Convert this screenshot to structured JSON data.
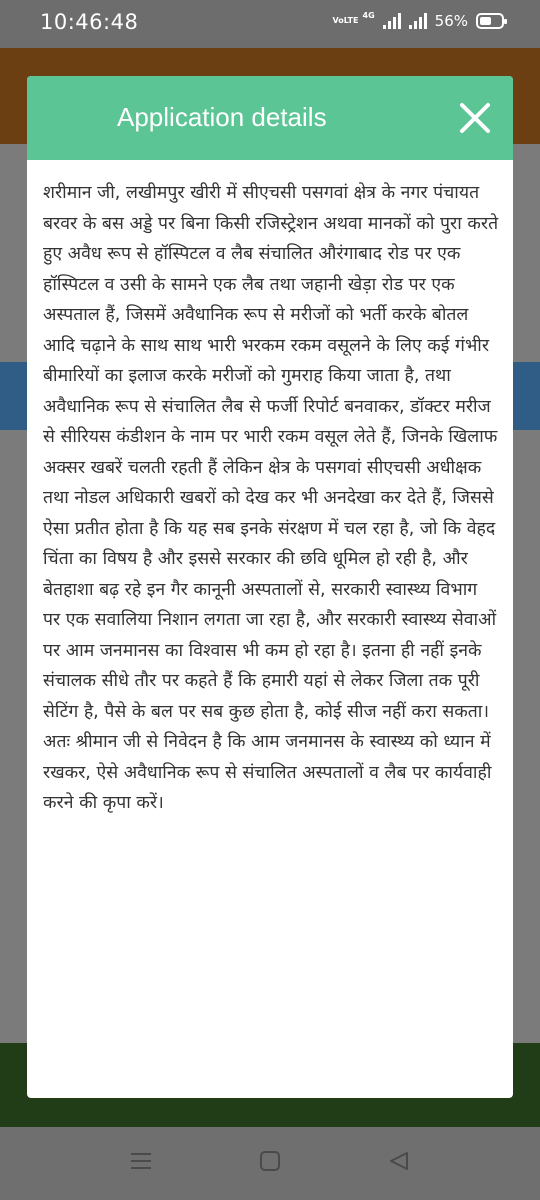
{
  "status_bar": {
    "time": "10:46:48",
    "volte_label": "VoLTE",
    "network": "4G",
    "battery_percent": "56%",
    "battery_level": 0.56
  },
  "dialog": {
    "title": "Application details",
    "close_icon": "close-x-icon",
    "header_color": "#5cc596",
    "body_text": "शरीमान जी, लखीमपुर खीरी में सीएचसी पसगवां क्षेत्र के नगर पंचायत बरवर के बस अड्डे पर बिना किसी रजिस्ट्रेशन अथवा मानकों को पुरा करते हुए अवैध रूप से हॉस्पिटल व लैब संचालित औरंगाबाद रोड पर एक हॉस्पिटल व उसी के सामने एक लैब तथा जहानी खेड़ा रोड पर एक अस्पताल हैं, जिसमें अवैधानिक रूप से मरीजों को भर्ती करके बोतल आदि चढ़ाने के साथ साथ भारी भरकम रकम वसूलने के लिए कई गंभीर बीमारियों का इलाज करके मरीजों को गुमराह किया जाता है, तथा अवैधानिक रूप से संचालित लैब से फर्जी रिपोर्ट बनवाकर, डॉक्टर मरीज से सीरियस कंडीशन के नाम पर भारी रकम वसूल लेते हैं, जिनके खिलाफ अक्सर खबरें चलती रहती हैं लेकिन क्षेत्र के पसगवां सीएचसी अधीक्षक तथा नोडल अधिकारी खबरों को देख कर भी अनदेखा कर देते हैं, जिससे ऐसा प्रतीत होता है कि यह सब इनके संरक्षण में चल रहा है, जो कि वेहद चिंता का विषय है और इससे सरकार की छवि धूमिल हो रही है, और बेतहाशा बढ़ रहे इन गैर कानूनी अस्पतालों से, सरकारी स्वास्थ्य विभाग पर एक सवालिया निशान लगता जा रहा है, और सरकारी स्वास्थ्य सेवाओं पर आम जनमानस का विश्वास भी कम हो रहा है। इतना ही नहीं इनके संचालक सीधे तौर पर कहते हैं कि हमारी यहां से लेकर जिला तक पूरी सेटिंग है, पैसे के बल पर सब कुछ होता है, कोई सीज नहीं करा सकता।      अतः श्रीमान जी से निवेदन है कि आम जनमानस के स्वास्थ्य को ध्यान में रखकर, ऐसे अवैधानिक रूप से संचालित अस्पतालों व लैब पर कार्यवाही करने की कृपा करें।"
  },
  "nav_bar": {
    "menu_icon": "menu-icon",
    "home_icon": "home-square-icon",
    "back_icon": "back-triangle-icon"
  }
}
